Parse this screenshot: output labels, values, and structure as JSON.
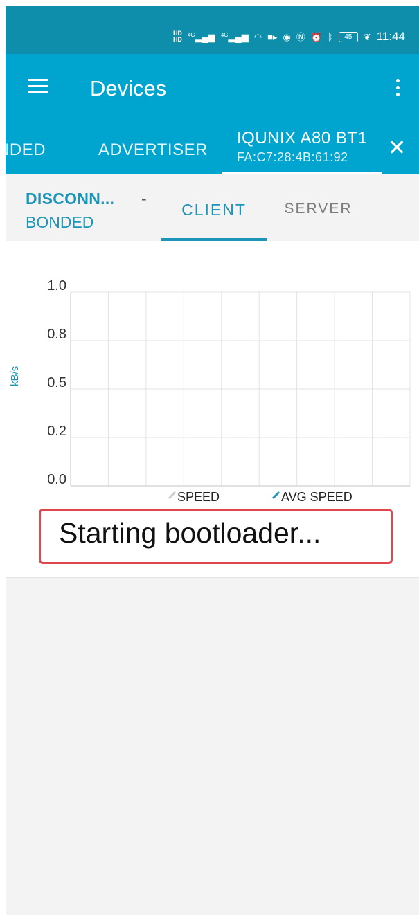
{
  "status_bar": {
    "time": "11:44",
    "battery": "45",
    "network": [
      "4G",
      "4G"
    ],
    "icons": [
      "hd-icon",
      "signal-icon",
      "signal-icon",
      "wifi-icon",
      "camera-icon",
      "eye-icon",
      "nfc-icon",
      "alarm-icon",
      "bluetooth-icon",
      "battery-icon",
      "leaf-icon"
    ]
  },
  "app_bar": {
    "title": "Devices"
  },
  "device_tabs": {
    "bonded": "NDED",
    "advertiser": "ADVERTISER",
    "device_name": "IQUNIX A80 BT1",
    "device_mac": "FA:C7:28:4B:61:92"
  },
  "connection": {
    "state": "DISCONN...",
    "separator": "-",
    "bond": "BONDED"
  },
  "sub_tabs": {
    "client": "CLIENT",
    "server": "SERVER"
  },
  "chart_data": {
    "type": "line",
    "ylabel": "kB/s",
    "xlabel": "",
    "ylim": [
      0.0,
      1.0
    ],
    "yticks": [
      {
        "value": 0.0,
        "label": "0.0"
      },
      {
        "value": 0.25,
        "label": "0.2"
      },
      {
        "value": 0.5,
        "label": "0.5"
      },
      {
        "value": 0.75,
        "label": "0.8"
      },
      {
        "value": 1.0,
        "label": "1.0"
      }
    ],
    "x_gridlines": 9,
    "grid": true,
    "legend_position": "bottom",
    "series": [
      {
        "name": "SPEED",
        "values": [],
        "color": "#cccccc"
      },
      {
        "name": "AVG SPEED",
        "values": [],
        "color": "#1c95b8"
      }
    ]
  },
  "status_message": "Starting bootloader...",
  "colors": {
    "status_bar": "#0e8eab",
    "app_bar": "#00a5cf",
    "accent": "#1c95b8",
    "highlight_box": "#e0474f"
  }
}
